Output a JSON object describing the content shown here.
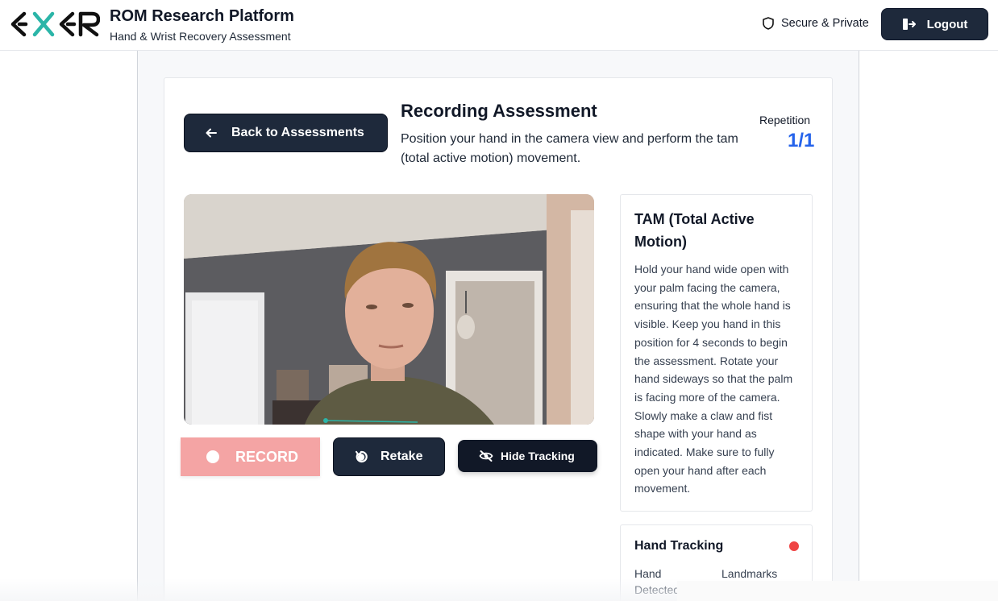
{
  "header": {
    "logo_text": "EXER",
    "title": "ROM Research Platform",
    "subtitle": "Hand & Wrist Recovery Assessment",
    "secure_label": "Secure & Private",
    "logout_label": "Logout"
  },
  "recording": {
    "back_label": "Back to Assessments",
    "title": "Recording Assessment",
    "instruction": "Position your hand in the camera view and perform the tam (total active motion) movement.",
    "repetition_label": "Repetition",
    "repetition_value": "1/1"
  },
  "controls": {
    "record_label": "RECORD",
    "retake_label": "Retake",
    "hide_tracking_label": "Hide Tracking"
  },
  "tam_panel": {
    "title": "TAM (Total Active Motion)",
    "description": "Hold your hand wide open with your palm facing the camera, ensuring that the whole hand is visible. Keep you hand in this position for 4 seconds to begin the assessment. Rotate your hand sideways so that the palm is facing more of the camera. Slowly make a claw and fist shape with your hand as indicated. Make sure to fully open your hand after each movement."
  },
  "hand_tracking": {
    "title": "Hand Tracking",
    "status_color": "#ef4444",
    "hand_detected_label": "Hand Detected",
    "landmarks_label": "Landmarks"
  },
  "colors": {
    "primary_dark": "#1e293b",
    "accent_blue": "#2563eb",
    "record_disabled": "#f4a4a4",
    "logo_teal": "#2bb5a8"
  }
}
